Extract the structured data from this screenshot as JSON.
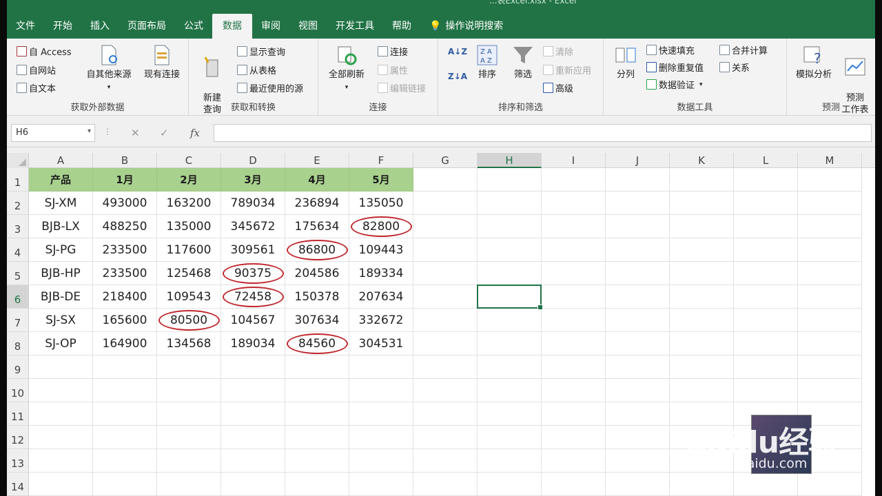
{
  "app": {
    "title_fragment": "...表Excel.xlsx - Excel"
  },
  "tabs": [
    "文件",
    "开始",
    "插入",
    "页面布局",
    "公式",
    "数据",
    "审阅",
    "视图",
    "开发工具",
    "帮助"
  ],
  "active_tab": "数据",
  "tell_me": "操作说明搜索",
  "ribbon": {
    "get_external": {
      "label": "获取外部数据",
      "access": "自 Access",
      "web": "自网站",
      "text": "自文本",
      "other": "自其他来源",
      "existing": "现有连接"
    },
    "get_transform": {
      "label": "获取和转换",
      "new_query": "新建\n查询",
      "show_queries": "显示查询",
      "from_table": "从表格",
      "recent": "最近使用的源"
    },
    "connections": {
      "label": "连接",
      "refresh_all": "全部刷新",
      "connections": "连接",
      "properties": "属性",
      "edit_links": "编辑链接"
    },
    "sort_filter": {
      "label": "排序和筛选",
      "sort": "排序",
      "filter": "筛选",
      "clear": "清除",
      "reapply": "重新应用",
      "advanced": "高级"
    },
    "data_tools": {
      "label": "数据工具",
      "split": "分列",
      "flash_fill": "快速填充",
      "remove_dup": "删除重复值",
      "validation": "数据验证",
      "consolidate": "合并计算",
      "relations": "关系"
    },
    "forecast": {
      "label": "预测",
      "what_if": "模拟分析",
      "forecast_sheet": "预测\n工作表"
    }
  },
  "formula_bar": {
    "name_box": "H6",
    "value": ""
  },
  "columns": [
    "A",
    "B",
    "C",
    "D",
    "E",
    "F",
    "G",
    "H",
    "I",
    "J",
    "K",
    "L",
    "M"
  ],
  "selected_col": "H",
  "selected_row": 6,
  "rows": [
    1,
    2,
    3,
    4,
    5,
    6,
    7,
    8,
    9,
    10,
    11,
    12,
    13,
    14
  ],
  "table": {
    "header": [
      "产品",
      "1月",
      "2月",
      "3月",
      "4月",
      "5月"
    ],
    "data": [
      [
        "SJ-XM",
        "493000",
        "163200",
        "789034",
        "236894",
        "135050"
      ],
      [
        "BJB-LX",
        "488250",
        "135000",
        "345672",
        "175634",
        "82800"
      ],
      [
        "SJ-PG",
        "233500",
        "117600",
        "309561",
        "86800",
        "109443"
      ],
      [
        "BJB-HP",
        "233500",
        "125468",
        "90375",
        "204586",
        "189334"
      ],
      [
        "BJB-DE",
        "218400",
        "109543",
        "72458",
        "150378",
        "207634"
      ],
      [
        "SJ-SX",
        "165600",
        "80500",
        "104567",
        "307634",
        "332672"
      ],
      [
        "SJ-OP",
        "164900",
        "134568",
        "189034",
        "84560",
        "304531"
      ]
    ]
  },
  "highlights": [
    {
      "row": 3,
      "col": "F"
    },
    {
      "row": 4,
      "col": "E"
    },
    {
      "row": 5,
      "col": "D"
    },
    {
      "row": 6,
      "col": "D"
    },
    {
      "row": 7,
      "col": "C"
    },
    {
      "row": 8,
      "col": "E"
    }
  ],
  "watermark": {
    "logo": "Baidu经验",
    "sub": "jingyan.baidu.com"
  },
  "colors": {
    "excel_green": "#217346",
    "header_fill": "#a9d18e",
    "highlight": "#c0282e"
  }
}
